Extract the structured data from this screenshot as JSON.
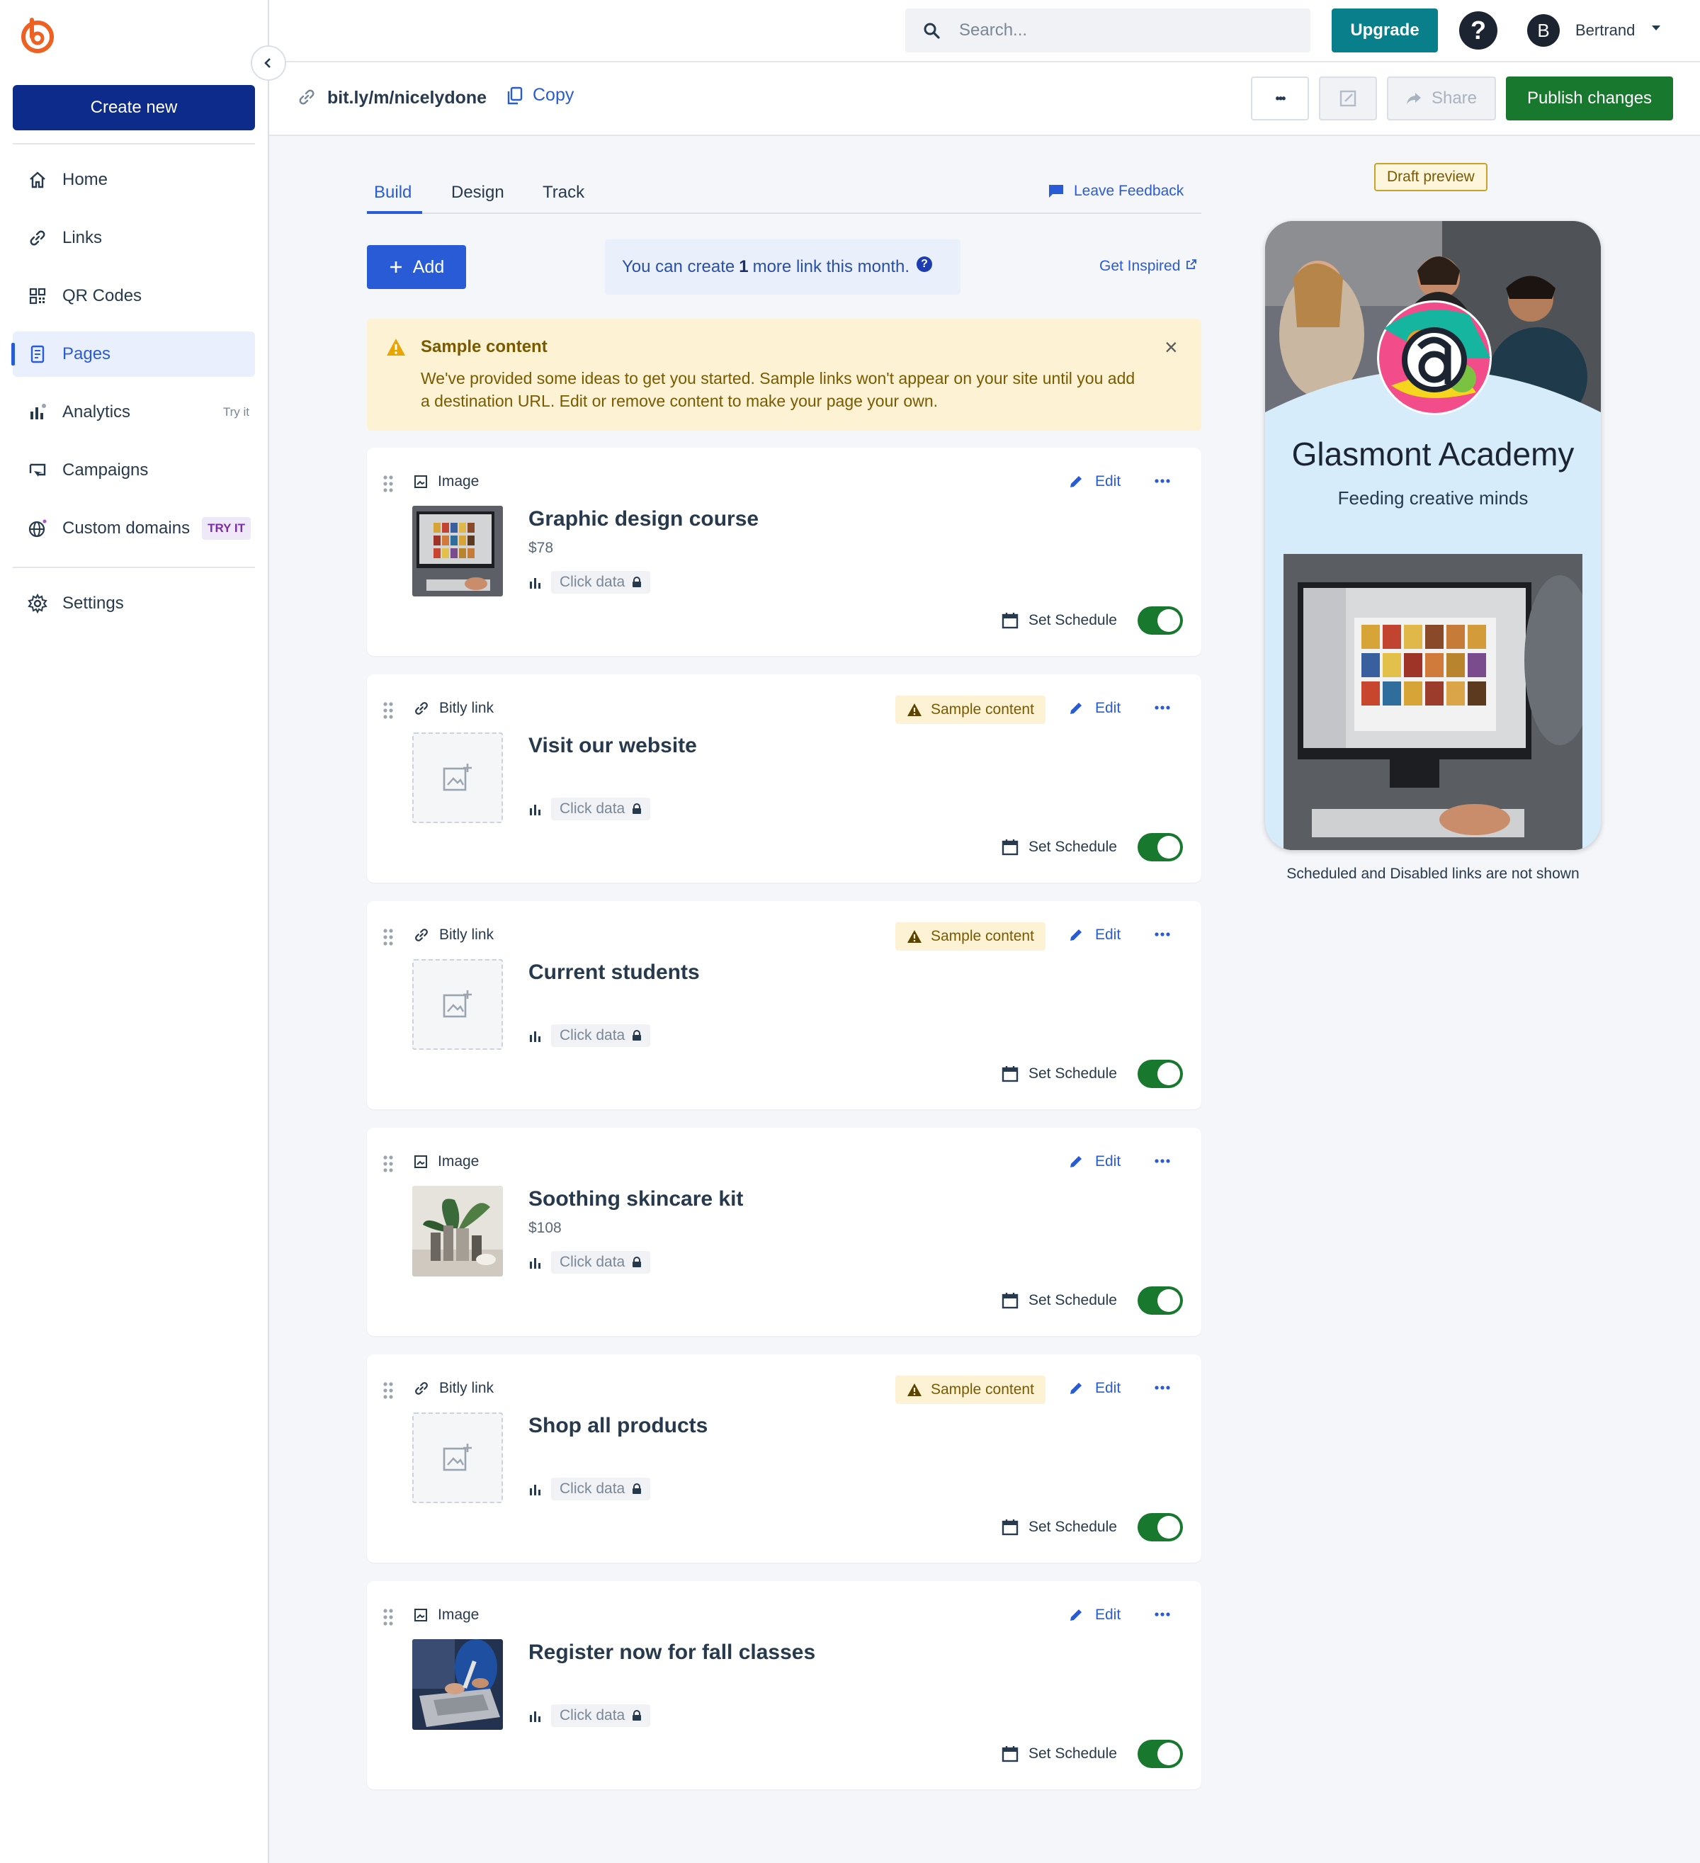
{
  "sidebar": {
    "create_label": "Create new",
    "items": [
      {
        "label": "Home",
        "icon": "home-icon"
      },
      {
        "label": "Links",
        "icon": "link-icon"
      },
      {
        "label": "QR Codes",
        "icon": "qr-code-icon"
      },
      {
        "label": "Pages",
        "icon": "page-icon",
        "active": true
      },
      {
        "label": "Analytics",
        "icon": "bar-chart-icon",
        "badge": "Try it"
      },
      {
        "label": "Campaigns",
        "icon": "campaign-icon"
      },
      {
        "label": "Custom domains",
        "icon": "globe-icon",
        "badge": "TRY IT"
      },
      {
        "label": "Settings",
        "icon": "gear-icon"
      }
    ]
  },
  "topbar": {
    "search_placeholder": "Search...",
    "upgrade_label": "Upgrade",
    "help_label": "?",
    "avatar_initial": "B",
    "username": "Bertrand"
  },
  "subbar": {
    "short_link": "bit.ly/m/nicelydone",
    "copy_label": "Copy",
    "more_label": "•••",
    "share_label": "Share",
    "publish_label": "Publish changes"
  },
  "tabs": [
    "Build",
    "Design",
    "Track"
  ],
  "feedback_label": "Leave Feedback",
  "add_label": "Add",
  "limit": {
    "prefix": "You can create",
    "count": "1",
    "suffix": "more link this month."
  },
  "inspired_label": "Get Inspired",
  "banner": {
    "title": "Sample content",
    "text": "We've provided some ideas to get you started. Sample links won't appear on your site until you add a destination URL. Edit or remove content to make your page your own.",
    "close": "×"
  },
  "card_labels": {
    "edit": "Edit",
    "click_data": "Click data",
    "schedule": "Set Schedule",
    "sample_badge": "Sample content"
  },
  "cards": [
    {
      "type": "Image",
      "title": "Graphic design course",
      "price": "$78",
      "sample": false,
      "thumb": "computer",
      "enabled": true
    },
    {
      "type": "Bitly link",
      "title": "Visit our website",
      "price": "",
      "sample": true,
      "thumb": "empty",
      "enabled": true
    },
    {
      "type": "Bitly link",
      "title": "Current students",
      "price": "",
      "sample": true,
      "thumb": "empty",
      "enabled": true
    },
    {
      "type": "Image",
      "title": "Soothing skincare kit",
      "price": "$108",
      "sample": false,
      "thumb": "skincare",
      "enabled": true
    },
    {
      "type": "Bitly link",
      "title": "Shop all products",
      "price": "",
      "sample": true,
      "thumb": "empty",
      "enabled": true
    },
    {
      "type": "Image",
      "title": "Register now for fall classes",
      "price": "",
      "sample": false,
      "thumb": "laptop",
      "enabled": true
    }
  ],
  "preview": {
    "badge": "Draft preview",
    "org_name": "Glasmont Academy",
    "tagline": "Feeding creative minds",
    "note": "Scheduled and Disabled links are not shown"
  },
  "colors": {
    "brand": "#ee6123",
    "primary": "#2a5bd7",
    "navy": "#0d2b8b",
    "publish": "#18792e",
    "upgrade": "#0a7f8c"
  }
}
